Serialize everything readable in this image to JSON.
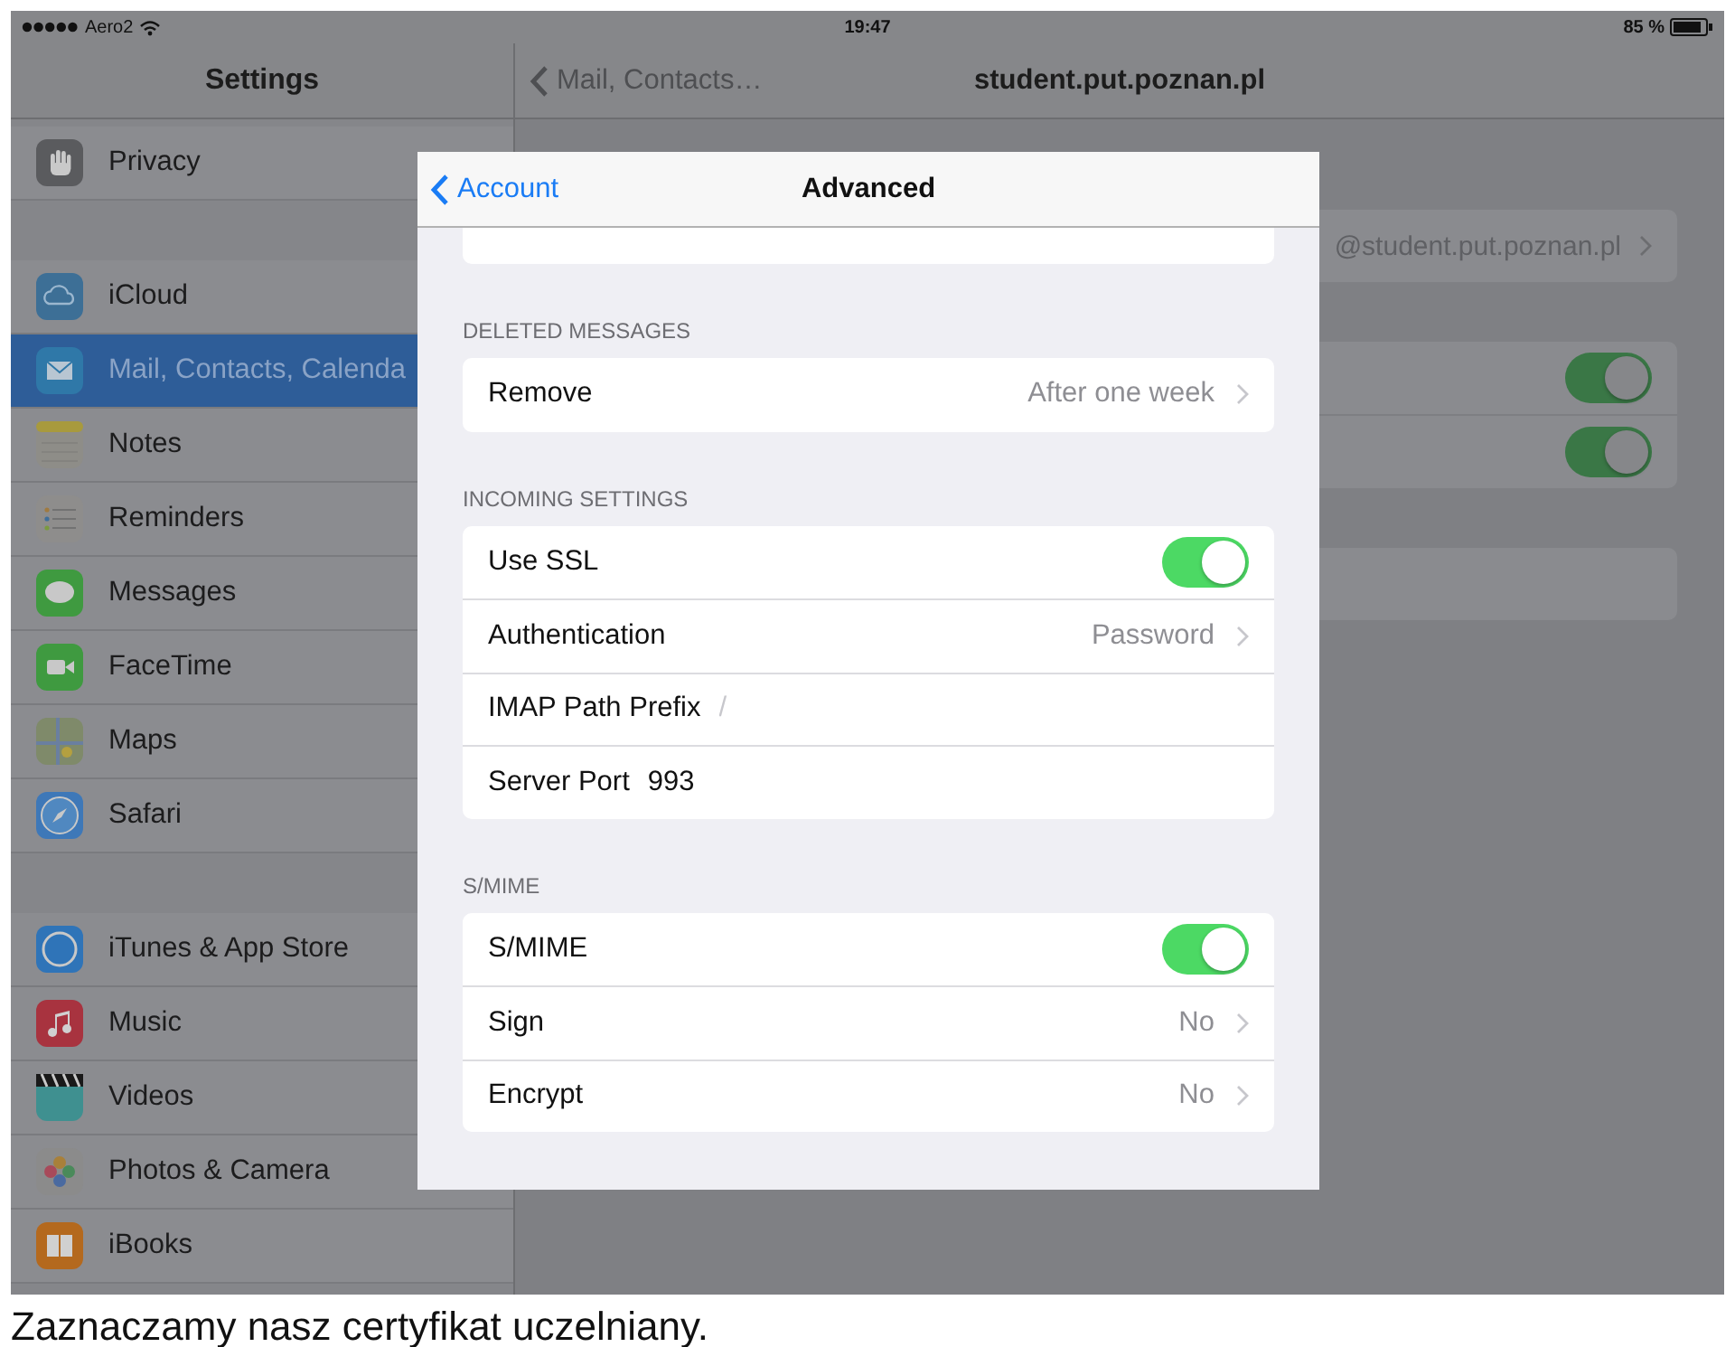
{
  "status_bar": {
    "carrier": "Aero2",
    "time": "19:47",
    "battery": "85 %"
  },
  "sidebar": {
    "title": "Settings",
    "groups": [
      [
        {
          "label": "Privacy",
          "selected": false
        }
      ],
      [
        {
          "label": "iCloud",
          "selected": false
        },
        {
          "label": "Mail, Contacts, Calenda",
          "selected": true
        },
        {
          "label": "Notes",
          "selected": false
        },
        {
          "label": "Reminders",
          "selected": false
        },
        {
          "label": "Messages",
          "selected": false
        },
        {
          "label": "FaceTime",
          "selected": false
        },
        {
          "label": "Maps",
          "selected": false
        },
        {
          "label": "Safari",
          "selected": false
        }
      ],
      [
        {
          "label": "iTunes & App Store",
          "selected": false
        },
        {
          "label": "Music",
          "selected": false
        },
        {
          "label": "Videos",
          "selected": false
        },
        {
          "label": "Photos & Camera",
          "selected": false
        },
        {
          "label": "iBooks",
          "selected": false
        }
      ]
    ]
  },
  "detail": {
    "back": "Mail, Contacts…",
    "title": "student.put.poznan.pl",
    "groups": [
      [
        {
          "kind": "value",
          "value": "@student.put.poznan.pl"
        }
      ],
      [
        {
          "kind": "toggle",
          "on": true
        },
        {
          "kind": "toggle",
          "on": true
        }
      ],
      [
        {
          "kind": "plain"
        }
      ]
    ]
  },
  "modal": {
    "back": "Account",
    "title": "Advanced",
    "sections": [
      {
        "header": "DELETED MESSAGES",
        "rows": [
          {
            "kind": "disclosure",
            "label": "Remove",
            "value": "After one week"
          }
        ]
      },
      {
        "header": "INCOMING SETTINGS",
        "rows": [
          {
            "kind": "toggle",
            "label": "Use SSL",
            "on": true
          },
          {
            "kind": "disclosure",
            "label": "Authentication",
            "value": "Password"
          },
          {
            "kind": "input",
            "label": "IMAP Path Prefix",
            "placeholder": "/"
          },
          {
            "kind": "input",
            "label": "Server Port",
            "value": "993"
          }
        ]
      },
      {
        "header": "S/MIME",
        "rows": [
          {
            "kind": "toggle",
            "label": "S/MIME",
            "on": true
          },
          {
            "kind": "disclosure",
            "label": "Sign",
            "value": "No"
          },
          {
            "kind": "disclosure",
            "label": "Encrypt",
            "value": "No"
          }
        ]
      }
    ]
  },
  "caption": "Zaznaczamy nasz certyfikat uczelniany."
}
